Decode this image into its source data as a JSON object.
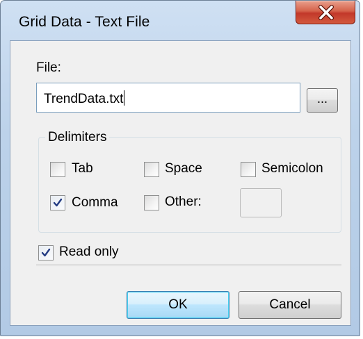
{
  "window": {
    "title": "Grid Data - Text File",
    "close_icon": "close-x-icon"
  },
  "file": {
    "label": "File:",
    "value": "TrendData.txt",
    "browse_label": "..."
  },
  "delimiters": {
    "group_label": "Delimiters",
    "options": {
      "tab": {
        "label": "Tab",
        "checked": false
      },
      "space": {
        "label": "Space",
        "checked": false
      },
      "semicolon": {
        "label": "Semicolon",
        "checked": false
      },
      "comma": {
        "label": "Comma",
        "checked": true
      },
      "other": {
        "label": "Other:",
        "checked": false,
        "value": ""
      }
    }
  },
  "read_only": {
    "label": "Read only",
    "checked": true
  },
  "buttons": {
    "ok": "OK",
    "cancel": "Cancel"
  },
  "colors": {
    "titlebar": "#bcd2ea",
    "close_button": "#c2382a",
    "dialog_background": "#f0f0f0",
    "default_button": "#bee6fd"
  }
}
